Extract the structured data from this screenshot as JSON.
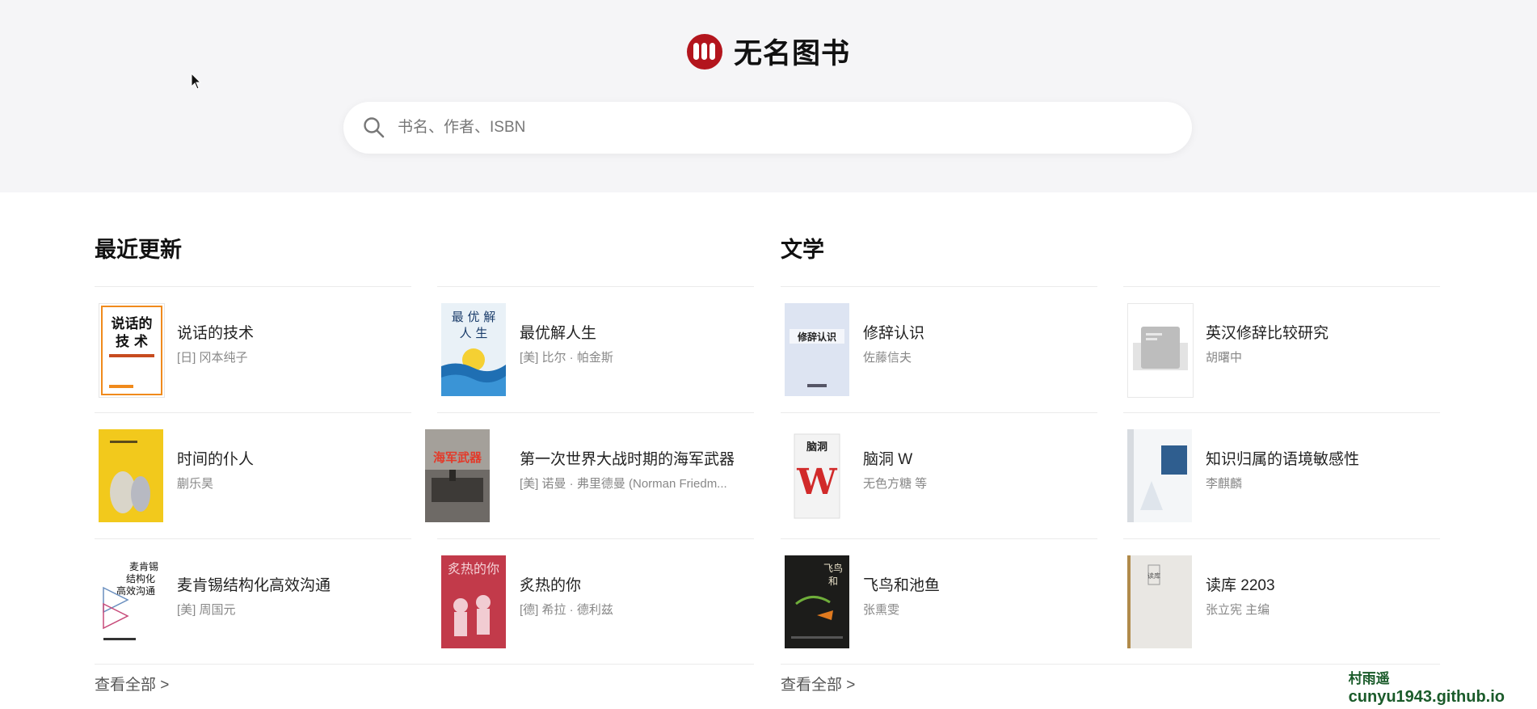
{
  "site": {
    "name": "无名图书"
  },
  "search": {
    "placeholder": "书名、作者、ISBN",
    "value": ""
  },
  "sections": [
    {
      "title": "最近更新",
      "view_all": "查看全部 >",
      "books": [
        {
          "title": "说话的技术",
          "author": "[日] 冈本纯子"
        },
        {
          "title": "最优解人生",
          "author": "[美] 比尔 · 帕金斯"
        },
        {
          "title": "时间的仆人",
          "author": "蒯乐昊"
        },
        {
          "title": "第一次世界大战时期的海军武器",
          "author": "[美] 诺曼 · 弗里德曼 (Norman Friedm..."
        },
        {
          "title": "麦肯锡结构化高效沟通",
          "author": "[美] 周国元"
        },
        {
          "title": "炙热的你",
          "author": "[德] 希拉 · 德利兹"
        }
      ]
    },
    {
      "title": "文学",
      "view_all": "查看全部 >",
      "books": [
        {
          "title": "修辞认识",
          "author": "佐藤信夫"
        },
        {
          "title": "英汉修辞比较研究",
          "author": "胡曙中"
        },
        {
          "title": "脑洞 W",
          "author": "无色方糖 等"
        },
        {
          "title": "知识归属的语境敏感性",
          "author": "李麒麟"
        },
        {
          "title": "飞鸟和池鱼",
          "author": "张熏雯"
        },
        {
          "title": "读库 2203",
          "author": "张立宪 主编"
        }
      ]
    }
  ],
  "covers": {
    "c0": {
      "text": "说话的技术",
      "sub": ""
    },
    "c1": {
      "text": "最优解人生"
    },
    "c4": {
      "text": "麦肯锡结构化高效沟通"
    },
    "c5": {
      "text": "炙热的你"
    },
    "c7": {
      "text": "脑洞"
    },
    "c9": {
      "text": "飞鸟和池鱼"
    },
    "c11": {
      "text": "读库"
    }
  },
  "watermark": {
    "name": "村雨遥",
    "url": "cunyu1943.github.io"
  },
  "colors": {
    "brand": "#b3151d",
    "header_bg": "#f5f5f7"
  }
}
